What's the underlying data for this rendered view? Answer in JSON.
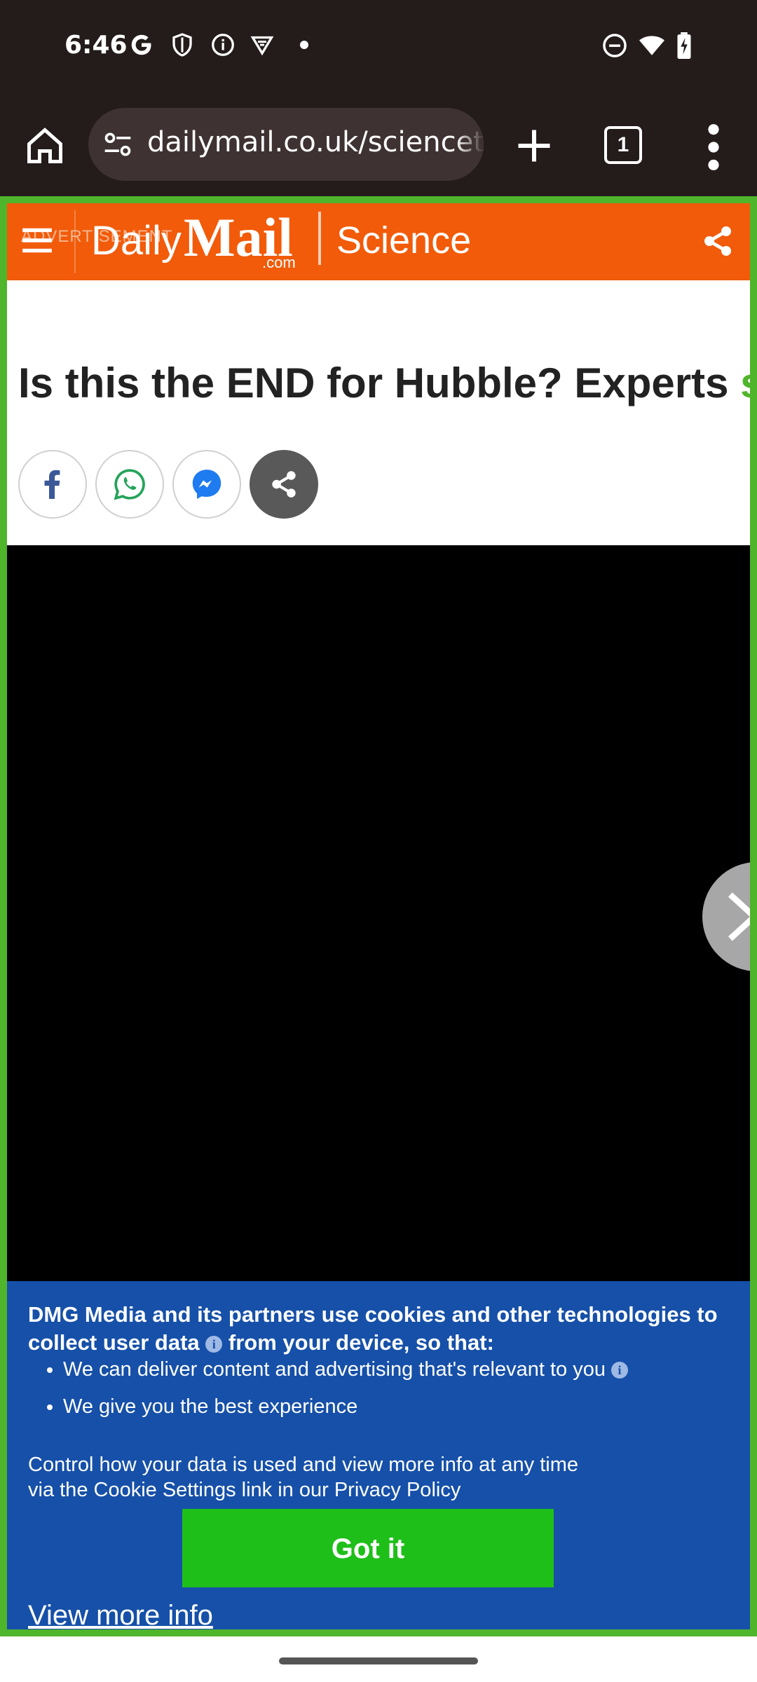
{
  "status_bar": {
    "time": "6:46",
    "icons": [
      "google-g-icon",
      "shield-icon",
      "info-icon",
      "vpn-icon",
      "dot-icon",
      "dnd-icon",
      "wifi-icon",
      "battery-icon"
    ]
  },
  "browser": {
    "url": "dailymail.co.uk/sciencet",
    "tab_count": "1"
  },
  "site_header": {
    "advert": "ADVERTISEMENT",
    "logo_daily": "Daily",
    "logo_mail": "Mail",
    "logo_com": ".com",
    "section": "Science"
  },
  "article": {
    "headline": "Is this the END for Hubble? Experts ",
    "headline_overflow": "s"
  },
  "cookie_banner": {
    "heading_part1": "DMG Media and its partners use cookies and other technologies to collect user data ",
    "heading_part2": " from your device, so that:",
    "bullet1": "We can deliver content and advertising that's relevant to you ",
    "bullet2": "We give you the best experience",
    "control_text": "Control how your data is used and view more info at any time via the Cookie Settings link in our Privacy Policy",
    "got_it": "Got it",
    "view_more": "View more info",
    "info_glyph": "i"
  },
  "colors": {
    "brand_orange": "#f15b0a",
    "banner_blue": "#1650a8",
    "button_green": "#1fbf1a",
    "frame_green": "#4fb52a"
  }
}
